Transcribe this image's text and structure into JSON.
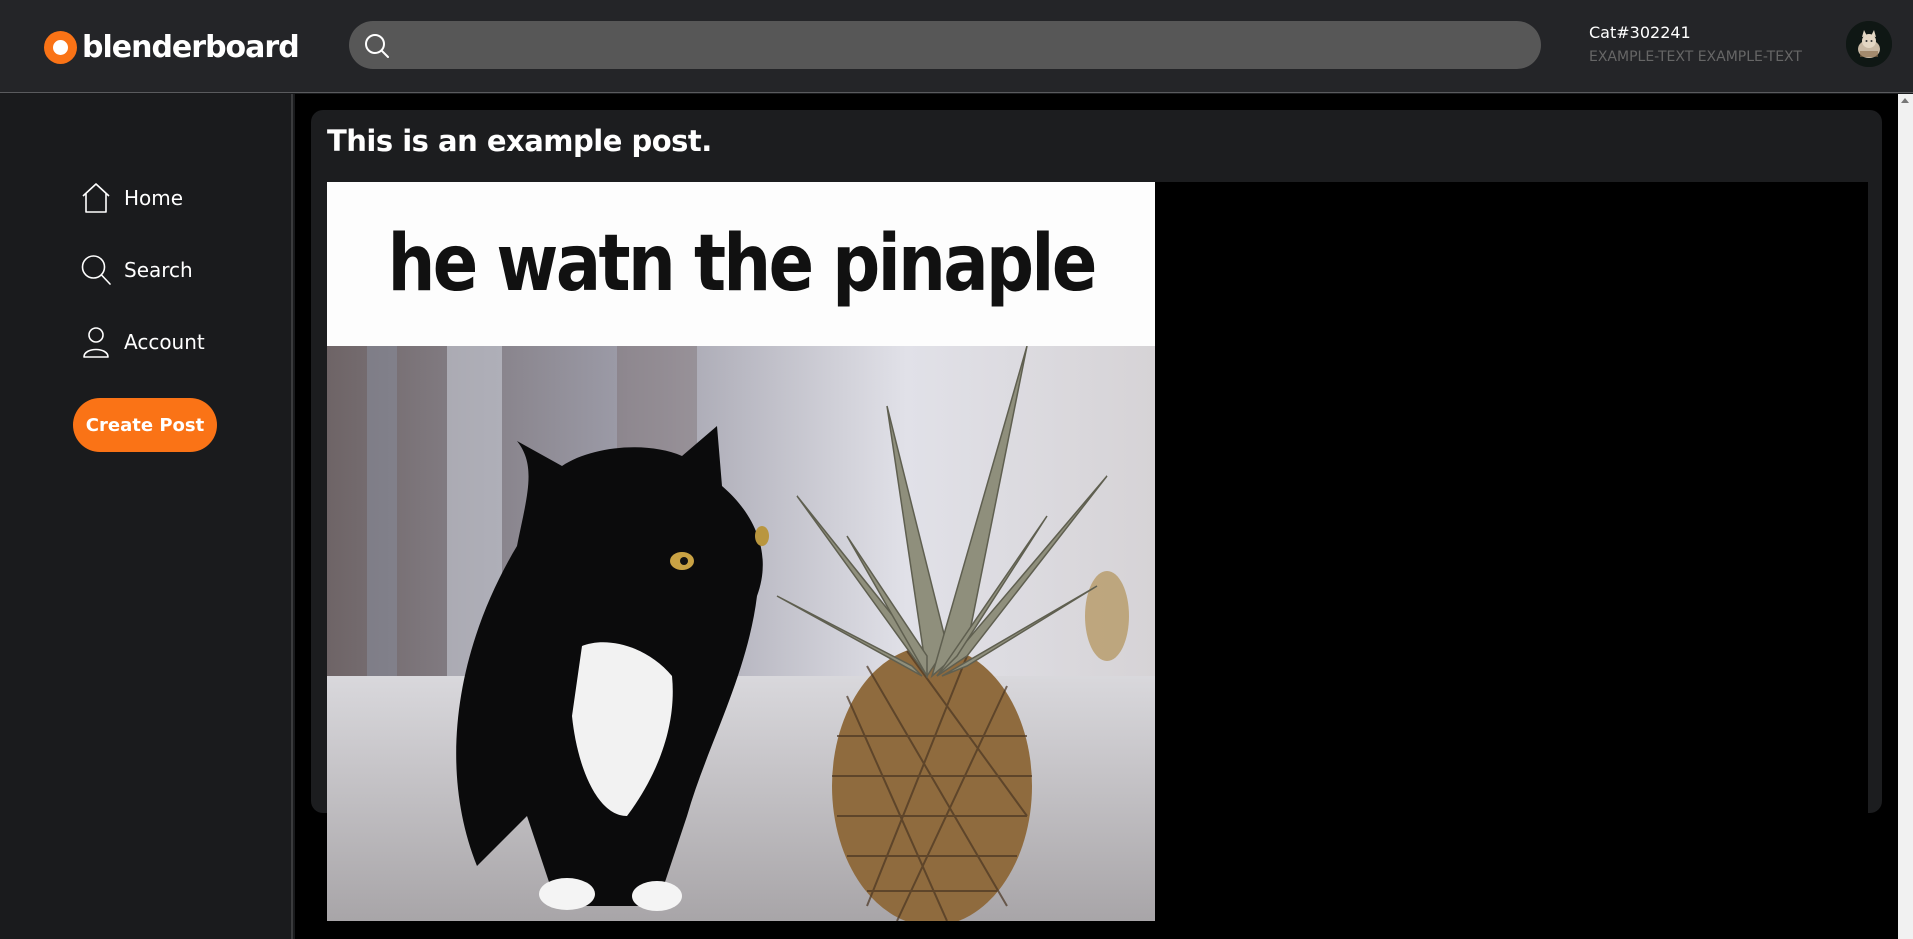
{
  "app": {
    "logo_text": "blenderboard",
    "brand_color": "#fa7316"
  },
  "header": {
    "search": {
      "placeholder": "",
      "value": "",
      "icon": "search-icon"
    },
    "user": {
      "name": "Cat#302241",
      "status": "EXAMPLE-TEXT EXAMPLE-TEXT"
    }
  },
  "sidebar": {
    "items": [
      {
        "label": "Home",
        "icon": "home-icon"
      },
      {
        "label": "Search",
        "icon": "search-icon"
      },
      {
        "label": "Account",
        "icon": "user-icon"
      }
    ],
    "create_label": "Create Post"
  },
  "post": {
    "title": "This is an example post.",
    "image_caption": "he watn the pinaple"
  }
}
